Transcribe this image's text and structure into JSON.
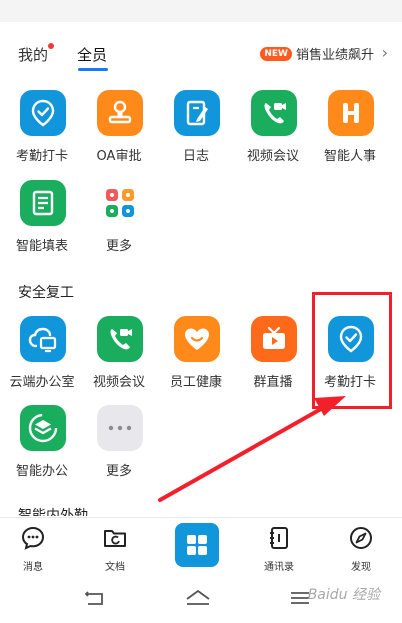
{
  "tabs": {
    "mine": "我的",
    "all": "全员"
  },
  "promo": {
    "badge": "NEW",
    "text": "销售业绩飙升"
  },
  "apps_row1": [
    {
      "label": "考勤打卡",
      "icon": "location-check-icon",
      "color": "#1296db"
    },
    {
      "label": "OA审批",
      "icon": "stamp-icon",
      "color": "#ff8a1a"
    },
    {
      "label": "日志",
      "icon": "notebook-pen-icon",
      "color": "#1296db"
    },
    {
      "label": "视频会议",
      "icon": "video-phone-icon",
      "color": "#1aad5e"
    },
    {
      "label": "智能人事",
      "icon": "h-letter-icon",
      "color": "#ff8a1a"
    }
  ],
  "apps_row2": [
    {
      "label": "智能填表",
      "icon": "form-icon",
      "color": "#1aad5e"
    },
    {
      "label": "更多",
      "icon": "more-grid-icon",
      "color": "#ffffff"
    }
  ],
  "section_title": "安全复工",
  "apps_row3": [
    {
      "label": "云端办公室",
      "icon": "cloud-office-icon",
      "color": "#1296db"
    },
    {
      "label": "视频会议",
      "icon": "video-phone-icon",
      "color": "#1aad5e"
    },
    {
      "label": "员工健康",
      "icon": "heart-smile-icon",
      "color": "#ff8a1a"
    },
    {
      "label": "群直播",
      "icon": "tv-live-icon",
      "color": "#ff6a1a"
    },
    {
      "label": "考勤打卡",
      "icon": "location-check-icon",
      "color": "#1296db"
    }
  ],
  "apps_row4": [
    {
      "label": "智能办公",
      "icon": "layers-icon",
      "color": "#1aad5e"
    },
    {
      "label": "更多",
      "icon": "ellipsis-icon",
      "color": "#e8e8ec"
    }
  ],
  "peek_title": "智能内外勤",
  "tabbar": [
    {
      "label": "消息",
      "icon": "chat-bubble-icon"
    },
    {
      "label": "文档",
      "icon": "folder-sync-icon"
    },
    {
      "label": "",
      "icon": "workbench-grid-icon"
    },
    {
      "label": "通讯录",
      "icon": "contacts-book-icon"
    },
    {
      "label": "发现",
      "icon": "compass-icon"
    }
  ],
  "watermark": "Baidu 经验"
}
